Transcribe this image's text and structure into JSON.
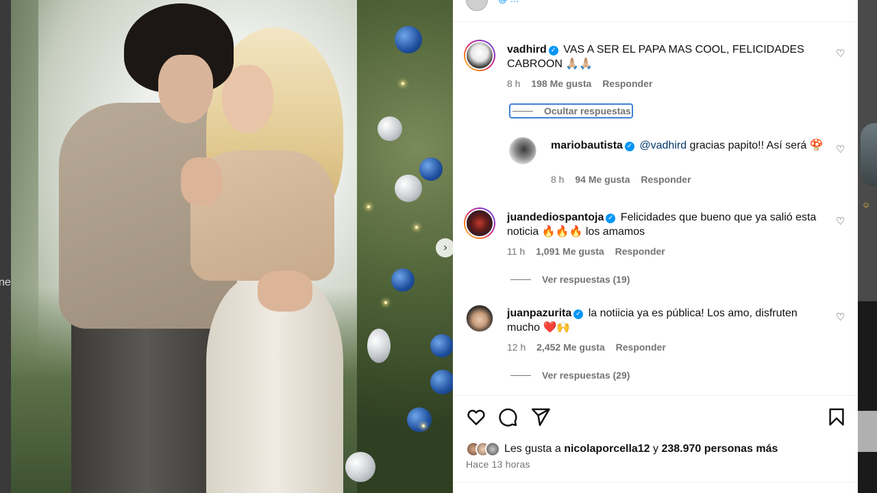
{
  "backdrop": {
    "left_text": "ne"
  },
  "top_partial": {
    "text": "@ ..."
  },
  "comments": [
    {
      "username": "vadhird",
      "verified": true,
      "text": "VAS A SER EL PAPA MAS COOL, FELICIDADES CABROON 🙏🏼🙏🏼",
      "time": "8 h",
      "likes": "198 Me gusta",
      "reply": "Responder",
      "replies_toggle": "Ocultar respuestas",
      "replies": [
        {
          "username": "mariobautista",
          "verified": true,
          "mention": "@vadhird",
          "text": "gracias papito!! Así será 🍄",
          "time": "8 h",
          "likes": "94 Me gusta",
          "reply": "Responder"
        }
      ]
    },
    {
      "username": "juandediospantoja",
      "verified": true,
      "text": "Felicidades que bueno que ya salió esta noticia 🔥🔥🔥 los amamos",
      "time": "11 h",
      "likes": "1,091 Me gusta",
      "reply": "Responder",
      "replies_toggle": "Ver respuestas (19)"
    },
    {
      "username": "juanpazurita",
      "verified": true,
      "text": "la notiicia ya es pública! Los amo, disfruten mucho ❤️🙌",
      "time": "12 h",
      "likes": "2,452 Me gusta",
      "reply": "Responder",
      "replies_toggle": "Ver respuestas (29)"
    }
  ],
  "likes_summary": {
    "prefix": "Les gusta a",
    "user": "nicolaporcella12",
    "middle": "y",
    "count": "238.970 personas más"
  },
  "posted": "Hace 13 horas",
  "icons": {
    "like": "heart-icon",
    "comment": "comment-icon",
    "share": "send-icon",
    "save": "bookmark-icon",
    "next": "chevron-right-icon"
  },
  "colors": {
    "link": "#0095f6",
    "muted": "#737373",
    "focus": "#3d7fd6"
  }
}
